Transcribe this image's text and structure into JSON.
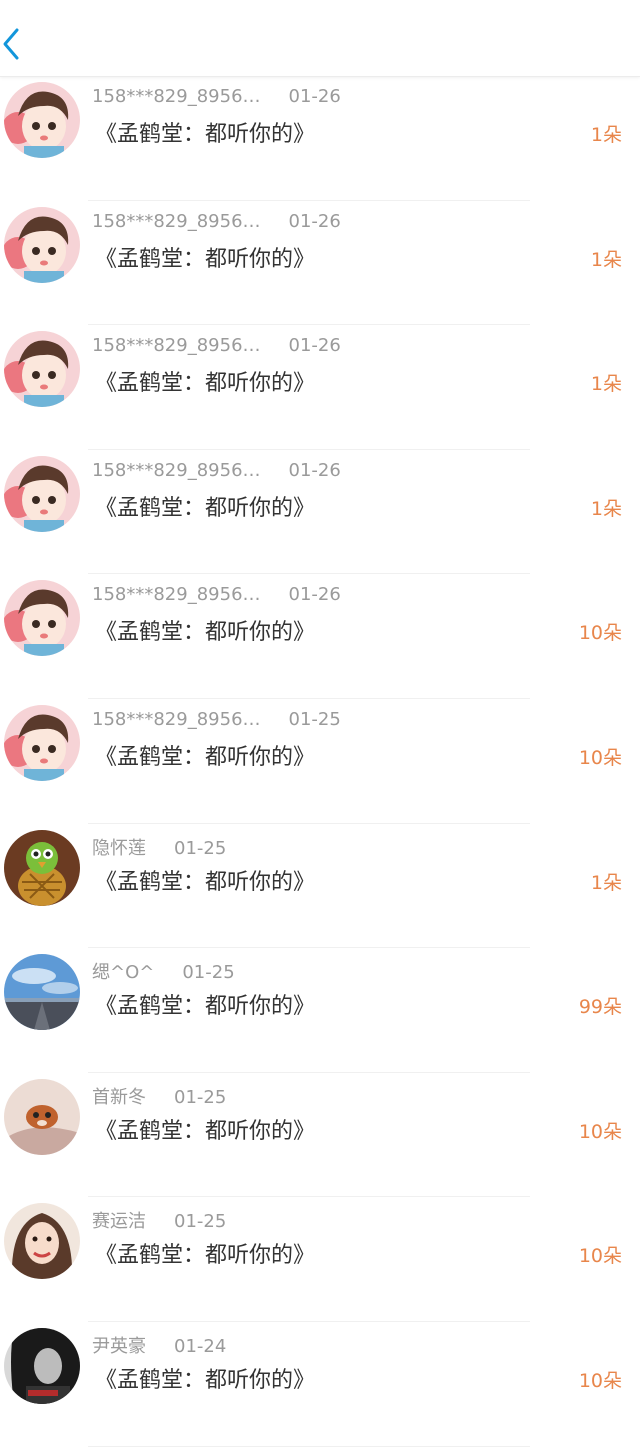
{
  "header": {
    "back_icon": "chevron-left-icon",
    "accent": "#1296db"
  },
  "colors": {
    "amount": "#e8864b",
    "meta": "#9a9a9a",
    "title": "#333333"
  },
  "records": [
    {
      "user": "158***829_8956…",
      "date": "01-26",
      "title": "《孟鹤堂：都听你的》",
      "amount": "1朵",
      "avatar": "anime"
    },
    {
      "user": "158***829_8956…",
      "date": "01-26",
      "title": "《孟鹤堂：都听你的》",
      "amount": "1朵",
      "avatar": "anime"
    },
    {
      "user": "158***829_8956…",
      "date": "01-26",
      "title": "《孟鹤堂：都听你的》",
      "amount": "1朵",
      "avatar": "anime"
    },
    {
      "user": "158***829_8956…",
      "date": "01-26",
      "title": "《孟鹤堂：都听你的》",
      "amount": "1朵",
      "avatar": "anime"
    },
    {
      "user": "158***829_8956…",
      "date": "01-26",
      "title": "《孟鹤堂：都听你的》",
      "amount": "10朵",
      "avatar": "anime"
    },
    {
      "user": "158***829_8956…",
      "date": "01-25",
      "title": "《孟鹤堂：都听你的》",
      "amount": "10朵",
      "avatar": "anime"
    },
    {
      "user": "隐怀莲",
      "date": "01-25",
      "title": "《孟鹤堂：都听你的》",
      "amount": "1朵",
      "avatar": "pineapple"
    },
    {
      "user": "缌^O^",
      "date": "01-25",
      "title": "《孟鹤堂：都听你的》",
      "amount": "99朵",
      "avatar": "sky"
    },
    {
      "user": "首新冬",
      "date": "01-25",
      "title": "《孟鹤堂：都听你的》",
      "amount": "10朵",
      "avatar": "pet"
    },
    {
      "user": "赛运洁",
      "date": "01-25",
      "title": "《孟鹤堂：都听你的》",
      "amount": "10朵",
      "avatar": "portrait"
    },
    {
      "user": "尹英豪",
      "date": "01-24",
      "title": "《孟鹤堂：都听你的》",
      "amount": "10朵",
      "avatar": "dark-portrait"
    }
  ]
}
